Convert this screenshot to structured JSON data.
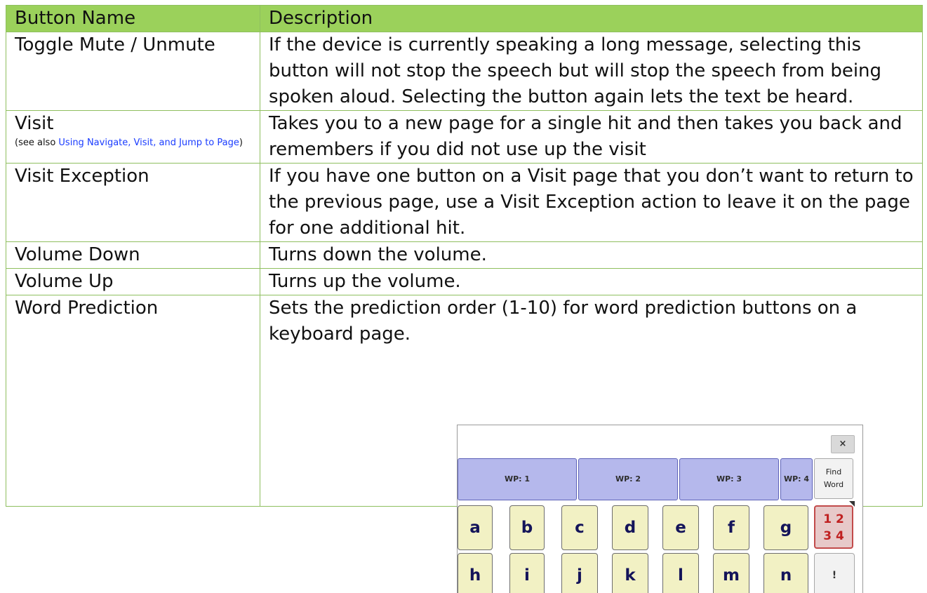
{
  "table": {
    "headers": [
      "Button Name",
      "Description"
    ],
    "rows": [
      {
        "name": "Toggle Mute / Unmute",
        "desc": "If the device is currently speaking a long message, selecting this button will not stop the speech but will stop the speech from being spoken aloud. Selecting the button again lets the text be heard."
      },
      {
        "name": "Visit",
        "note_prefix": "(see also ",
        "note_link": "Using Navigate, Visit, and Jump to Page",
        "note_suffix": ")",
        "desc": "Takes you to a new page for a single hit and then takes you back and remembers if you did not use up the visit"
      },
      {
        "name": "Visit Exception",
        "desc": "If you have one button on a Visit page that you don’t want to return to the previous page, use a Visit Exception action to leave it on the page for one additional hit."
      },
      {
        "name": "Volume Down",
        "desc": "Turns down the volume."
      },
      {
        "name": "Volume Up",
        "desc": "Turns up the volume."
      },
      {
        "name": "Word Prediction",
        "desc": "Sets the prediction order (1-10) for word prediction buttons on a keyboard page."
      }
    ]
  },
  "screenshot": {
    "close_label": "×",
    "wp_buttons": [
      "WP: 1",
      "WP: 2",
      "WP: 3",
      "WP: 4"
    ],
    "find_line1": "Find",
    "find_line2": "Word",
    "keys_row1": [
      "a",
      "b",
      "c",
      "d",
      "e",
      "f",
      "g"
    ],
    "num_key_top": "1 2",
    "num_key_bottom": "3 4",
    "keys_row2": [
      "h",
      "i",
      "j",
      "k",
      "l",
      "m",
      "n",
      "!"
    ]
  }
}
